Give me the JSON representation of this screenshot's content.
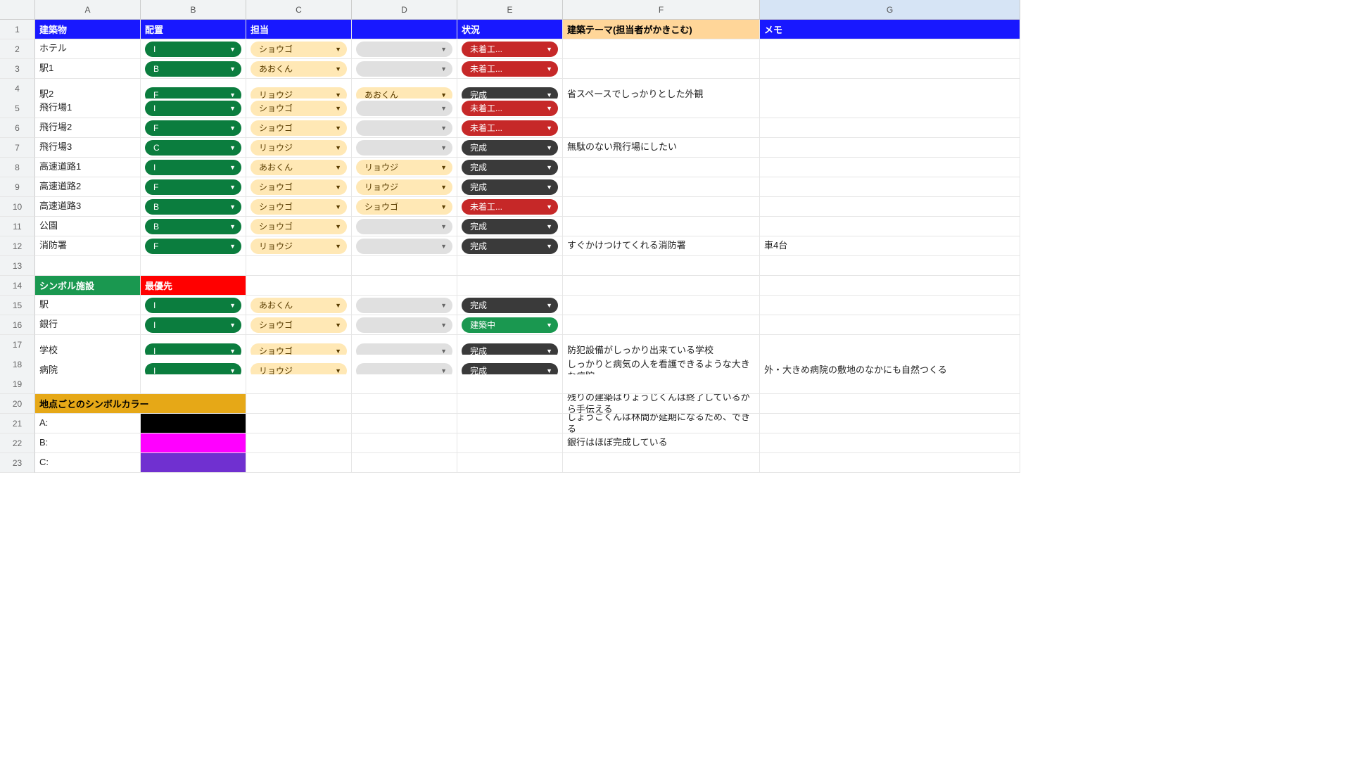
{
  "columns": [
    "A",
    "B",
    "C",
    "D",
    "E",
    "F",
    "G"
  ],
  "headers": {
    "A": "建築物",
    "B": "配置",
    "C": "担当",
    "E": "状況",
    "F": "建築テーマ(担当者がかきこむ)",
    "G": "メモ"
  },
  "rows": [
    {
      "n": 2,
      "A": "ホテル",
      "B": {
        "t": "I",
        "c": "green"
      },
      "C": {
        "t": "ショウゴ",
        "c": "cream"
      },
      "D": {
        "t": "",
        "c": "grey"
      },
      "E": {
        "t": "未着工...",
        "c": "red"
      }
    },
    {
      "n": 3,
      "A": "駅1",
      "B": {
        "t": "B",
        "c": "green"
      },
      "C": {
        "t": "あおくん",
        "c": "cream"
      },
      "D": {
        "t": "",
        "c": "grey"
      },
      "E": {
        "t": "未着工...",
        "c": "red"
      }
    },
    {
      "n": 4,
      "tall": true,
      "A": "駅2",
      "B": {
        "t": "F",
        "c": "green"
      },
      "C": {
        "t": "リョウジ",
        "c": "cream"
      },
      "D": {
        "t": "あおくん",
        "c": "cream"
      },
      "E": {
        "t": "完成",
        "c": "dark"
      },
      "F": "省スペースでしっかりとした外観"
    },
    {
      "n": 5,
      "A": "飛行場1",
      "B": {
        "t": "I",
        "c": "green"
      },
      "C": {
        "t": "ショウゴ",
        "c": "cream"
      },
      "D": {
        "t": "",
        "c": "grey"
      },
      "E": {
        "t": "未着工...",
        "c": "red"
      }
    },
    {
      "n": 6,
      "A": "飛行場2",
      "B": {
        "t": "F",
        "c": "green"
      },
      "C": {
        "t": "ショウゴ",
        "c": "cream"
      },
      "D": {
        "t": "",
        "c": "grey"
      },
      "E": {
        "t": "未着工...",
        "c": "red"
      }
    },
    {
      "n": 7,
      "A": "飛行場3",
      "B": {
        "t": "C",
        "c": "green"
      },
      "C": {
        "t": "リョウジ",
        "c": "cream"
      },
      "D": {
        "t": "",
        "c": "grey"
      },
      "E": {
        "t": "完成",
        "c": "dark"
      },
      "F": "無駄のない飛行場にしたい"
    },
    {
      "n": 8,
      "A": "高速道路1",
      "B": {
        "t": "I",
        "c": "green"
      },
      "C": {
        "t": "あおくん",
        "c": "cream"
      },
      "D": {
        "t": "リョウジ",
        "c": "cream"
      },
      "E": {
        "t": "完成",
        "c": "dark"
      }
    },
    {
      "n": 9,
      "A": "高速道路2",
      "B": {
        "t": "F",
        "c": "green"
      },
      "C": {
        "t": "ショウゴ",
        "c": "cream"
      },
      "D": {
        "t": "リョウジ",
        "c": "cream"
      },
      "E": {
        "t": "完成",
        "c": "dark"
      }
    },
    {
      "n": 10,
      "A": "高速道路3",
      "B": {
        "t": "B",
        "c": "green"
      },
      "C": {
        "t": "ショウゴ",
        "c": "cream"
      },
      "D": {
        "t": "ショウゴ",
        "c": "cream"
      },
      "E": {
        "t": "未着工...",
        "c": "red"
      }
    },
    {
      "n": 11,
      "A": "公園",
      "B": {
        "t": "B",
        "c": "green"
      },
      "C": {
        "t": "ショウゴ",
        "c": "cream"
      },
      "D": {
        "t": "",
        "c": "grey"
      },
      "E": {
        "t": "完成",
        "c": "dark"
      }
    },
    {
      "n": 12,
      "A": "消防署",
      "B": {
        "t": "F",
        "c": "green"
      },
      "C": {
        "t": "リョウジ",
        "c": "cream"
      },
      "D": {
        "t": "",
        "c": "grey"
      },
      "E": {
        "t": "完成",
        "c": "dark"
      },
      "F": "すぐかけつけてくれる消防署",
      "G": "車4台"
    },
    {
      "n": 13
    },
    {
      "n": 14,
      "A": {
        "header": "green",
        "t": "シンボル施設"
      },
      "B": {
        "header": "red",
        "t": "最優先"
      }
    },
    {
      "n": 15,
      "A": "駅",
      "B": {
        "t": "I",
        "c": "green"
      },
      "C": {
        "t": "あおくん",
        "c": "cream"
      },
      "D": {
        "t": "",
        "c": "grey"
      },
      "E": {
        "t": "完成",
        "c": "dark"
      }
    },
    {
      "n": 16,
      "A": "銀行",
      "B": {
        "t": "I",
        "c": "green"
      },
      "C": {
        "t": "ショウゴ",
        "c": "cream"
      },
      "D": {
        "t": "",
        "c": "grey"
      },
      "E": {
        "t": "建築中",
        "c": "buildG"
      }
    },
    {
      "n": 17,
      "tall": true,
      "A": "学校",
      "B": {
        "t": "I",
        "c": "green"
      },
      "C": {
        "t": "ショウゴ",
        "c": "cream"
      },
      "D": {
        "t": "",
        "c": "grey"
      },
      "E": {
        "t": "完成",
        "c": "dark"
      },
      "F": "防犯設備がしっかり出来ている学校"
    },
    {
      "n": 18,
      "tall": true,
      "A": "病院",
      "B": {
        "t": "I",
        "c": "green"
      },
      "C": {
        "t": "リョウジ",
        "c": "cream"
      },
      "D": {
        "t": "",
        "c": "grey"
      },
      "E": {
        "t": "完成",
        "c": "dark"
      },
      "F": "しっかりと病気の人を看護できるような大きな病院",
      "G": "外・大きめ病院の敷地のなかにも自然つくる"
    },
    {
      "n": 19
    },
    {
      "n": 20,
      "A": {
        "header": "gold",
        "t": "地点ごとのシンボルカラー",
        "span": 2
      },
      "F": "残りの建築はりょうじくんは終了しているから手伝える"
    },
    {
      "n": 21,
      "A": "A:",
      "B": {
        "swatch": "black"
      },
      "F": "しょうごくんは林間が延期になるため、できる"
    },
    {
      "n": 22,
      "A": "B:",
      "B": {
        "swatch": "magenta"
      },
      "F": "銀行はほぼ完成している"
    },
    {
      "n": 23,
      "A": "C:",
      "B": {
        "swatch": "purple"
      }
    }
  ]
}
